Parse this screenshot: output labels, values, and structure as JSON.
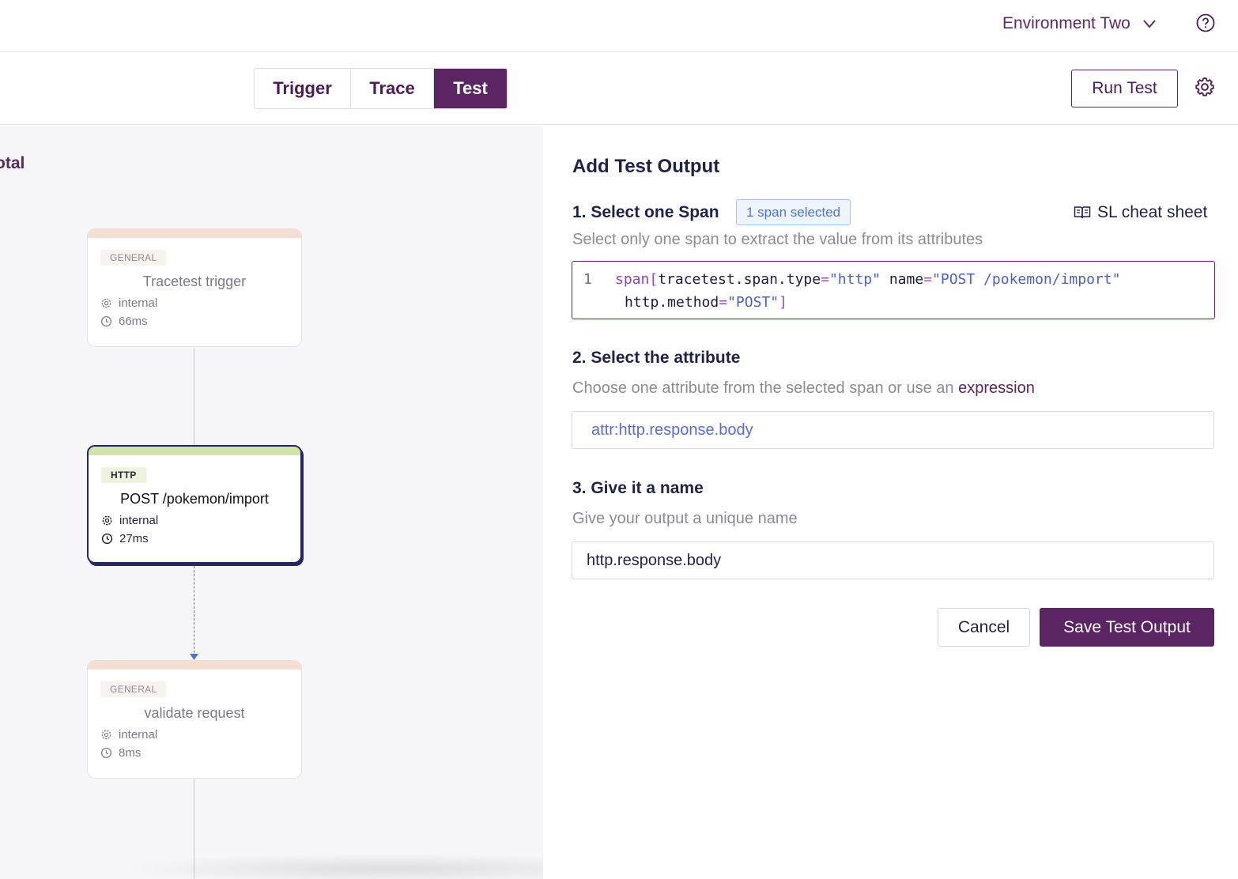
{
  "header": {
    "environment": "Environment Two",
    "environment_icon": "chevron-down-icon",
    "help_icon": "question-circle-icon"
  },
  "tabs": [
    {
      "label": "Trigger",
      "active": false
    },
    {
      "label": "Trace",
      "active": false
    },
    {
      "label": "Test",
      "active": true
    }
  ],
  "toolbar": {
    "run_test_label": "Run Test",
    "settings_icon": "gear-icon"
  },
  "canvas": {
    "total_label": "otal",
    "nodes": [
      {
        "type": "GENERAL",
        "name": "Tracetest trigger",
        "kind": "internal",
        "duration": "66ms",
        "selected": false
      },
      {
        "type": "HTTP",
        "name": "POST /pokemon/import",
        "kind": "internal",
        "duration": "27ms",
        "selected": true
      },
      {
        "type": "GENERAL",
        "name": "validate request",
        "kind": "internal",
        "duration": "8ms",
        "selected": false
      }
    ]
  },
  "form": {
    "title": "Add Test Output",
    "step1": {
      "title": "1. Select one Span",
      "badge": "1 span selected",
      "cheat_sheet": "SL cheat sheet",
      "help": "Select only one span to extract the value from its attributes",
      "line_number": "1",
      "code": {
        "kw": "span",
        "open": "[",
        "attr1": "tracetest.span.type",
        "eq1": "=",
        "val1": "\"http\"",
        "attr2": "name",
        "eq2": "=",
        "val2": "\"POST /pokemon/import\"",
        "attr3": "http.method",
        "eq3": "=",
        "val3": "\"POST\"",
        "close": "]"
      }
    },
    "step2": {
      "title": "2. Select the attribute",
      "help": "Choose one attribute from the selected span or use an",
      "help_link": "expression",
      "value": "attr:http.response.body"
    },
    "step3": {
      "title": "3. Give it a name",
      "help": "Give your output a unique name",
      "value": "http.response.body"
    },
    "cancel_label": "Cancel",
    "save_label": "Save Test Output"
  },
  "colors": {
    "brand": "#5b2463",
    "selected_node_border": "#24256a",
    "http_bar": "#cfe5a5",
    "general_bar": "#f5dfd2",
    "badge_blue": "#4a7ac8"
  }
}
